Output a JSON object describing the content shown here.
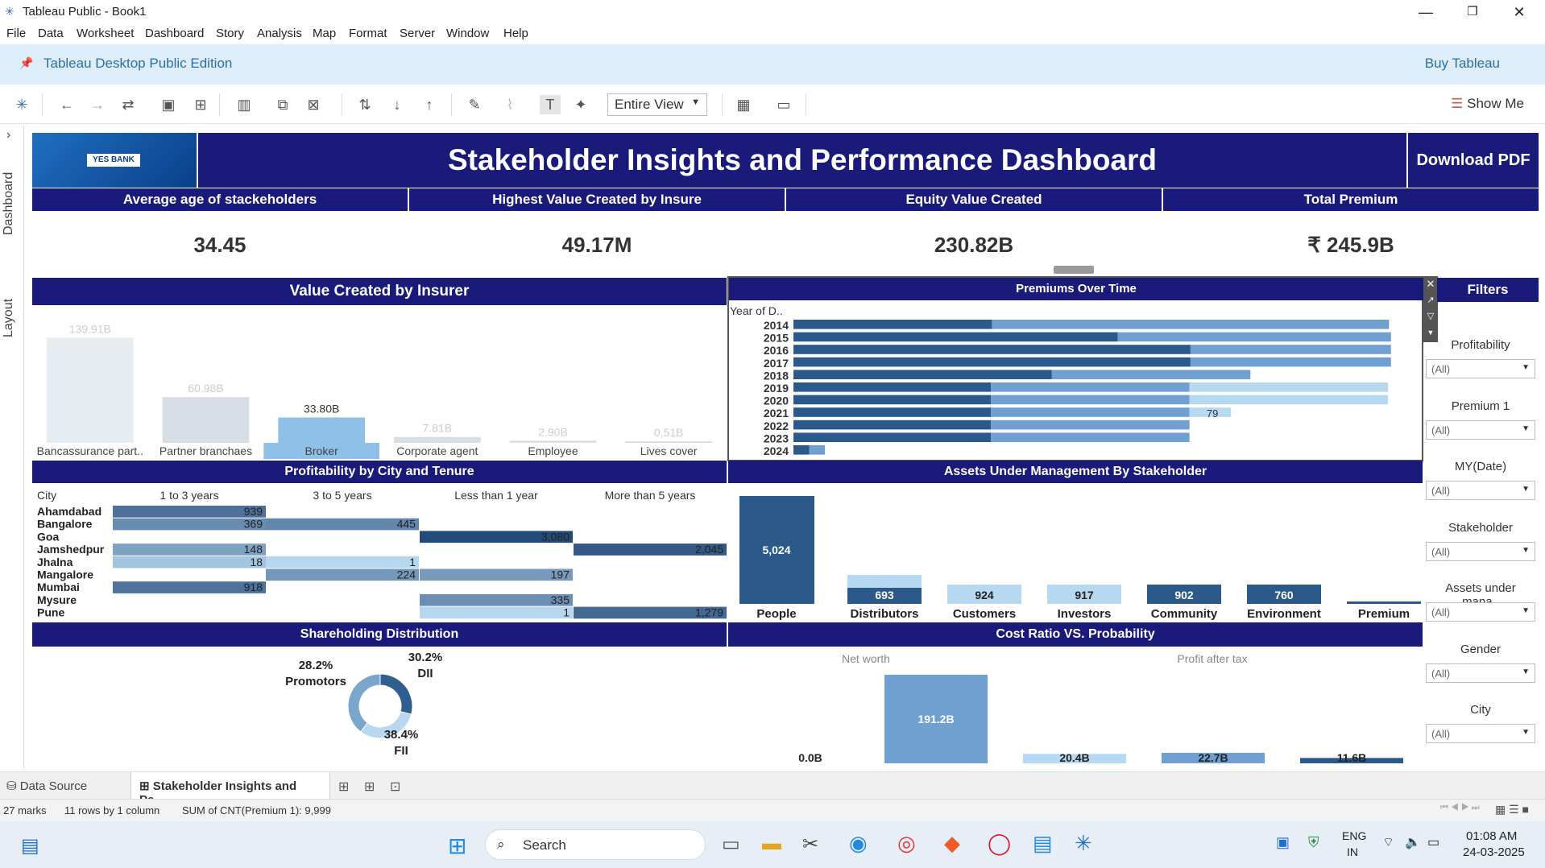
{
  "window": {
    "title": "Tableau Public - Book1",
    "minimize": "—",
    "maximize": "❐",
    "close": "✕"
  },
  "menu": [
    "File",
    "Data",
    "Worksheet",
    "Dashboard",
    "Story",
    "Analysis",
    "Map",
    "Format",
    "Server",
    "Window",
    "Help"
  ],
  "banner": {
    "edition": "Tableau Desktop Public Edition",
    "buy": "Buy Tableau"
  },
  "toolbar": {
    "fit": "Entire View",
    "show_me": "Show Me"
  },
  "side_tabs": {
    "dashboard": "Dashboard",
    "layout": "Layout",
    "toggle": "›"
  },
  "dashboard": {
    "logo_text": "YES BANK",
    "title": "Stakeholder Insights and Performance Dashboard",
    "download": "Download PDF",
    "kpis": [
      {
        "label": "Average age of stackeholders",
        "value": "34.45"
      },
      {
        "label": "Highest Value Created by Insure",
        "value": "49.17M"
      },
      {
        "label": "Equity Value Created",
        "value": "230.82B"
      },
      {
        "label": "Total Premium",
        "value": "₹ 245.9B"
      }
    ],
    "value_created": {
      "title": "Value Created by  Insurer",
      "chart_data": {
        "type": "bar",
        "categories": [
          "Bancassurance part..",
          "Partner branchaes",
          "Broker",
          "Corporate agent",
          "Employee",
          "Lives cover"
        ],
        "values": [
          139.91,
          60.98,
          33.8,
          7.81,
          2.9,
          0.51
        ],
        "labels": [
          "139.91B",
          "60.98B",
          "33.80B",
          "7.81B",
          "2.90B",
          "0.51B"
        ],
        "highlight": "Broker",
        "colors": {
          "highlight": "#8fc1e8",
          "faded": "#e6ecf0",
          "faded2": "#d8dee6"
        }
      }
    },
    "premiums": {
      "title": "Premiums Over Time",
      "axis_header": "Year of D..",
      "chart_data": {
        "type": "bar",
        "categories": [
          "2014",
          "2015",
          "2016",
          "2017",
          "2018",
          "2019",
          "2020",
          "2021",
          "2022",
          "2023",
          "2024"
        ],
        "series": [
          {
            "values": [
              202,
              330,
              404,
              404,
              263,
              201,
              201,
              201,
              201,
              201,
              16
            ]
          },
          {
            "values": [
              404,
              278,
              204,
              204,
              202,
              202,
              202,
              202,
              202,
              202,
              16
            ]
          },
          {
            "values": [
              0,
              0,
              0,
              0,
              0,
              202,
              202,
              42,
              0,
              0,
              0
            ]
          }
        ],
        "annotations": [
          {
            "category": "2021",
            "text": "79"
          }
        ]
      }
    },
    "filters": {
      "title": "Filters",
      "items": [
        {
          "label": "Profitability",
          "value": "(All)"
        },
        {
          "label": "Premium 1",
          "value": "(All)"
        },
        {
          "label": "MY(Date)",
          "value": "(All)"
        },
        {
          "label": "Stakeholder",
          "value": "(All)"
        },
        {
          "label": "Assets under mana..",
          "value": "(All)"
        },
        {
          "label": "Gender",
          "value": "(All)"
        },
        {
          "label": "City",
          "value": "(All)"
        }
      ]
    },
    "profitability": {
      "title": "Profitability by City and Tenure",
      "header_city": "City",
      "chart_data": {
        "type": "heatmap",
        "columns": [
          "1 to 3 years",
          "3 to 5 years",
          "Less than 1 year",
          "More than 5 years"
        ],
        "rows": [
          {
            "city": "Ahamdabad",
            "values": [
              939,
              null,
              null,
              null
            ]
          },
          {
            "city": "Bangalore",
            "values": [
              369,
              445,
              null,
              null
            ]
          },
          {
            "city": "Goa",
            "values": [
              null,
              null,
              3080,
              null
            ]
          },
          {
            "city": "Jamshedpur",
            "values": [
              148,
              null,
              null,
              2045
            ]
          },
          {
            "city": "Jhalna",
            "values": [
              18,
              1,
              null,
              null
            ]
          },
          {
            "city": "Mangalore",
            "values": [
              null,
              224,
              197,
              null
            ]
          },
          {
            "city": "Mumbai",
            "values": [
              918,
              null,
              null,
              null
            ]
          },
          {
            "city": "Mysure",
            "values": [
              null,
              null,
              335,
              null
            ]
          },
          {
            "city": "Pune",
            "values": [
              null,
              null,
              1,
              1279
            ]
          }
        ],
        "labels": {
          "Ahamdabad": [
            "939",
            "",
            "",
            ""
          ],
          "Bangalore": [
            "369",
            "445",
            "",
            ""
          ],
          "Goa": [
            "",
            "",
            "3,080",
            ""
          ],
          "Jamshedpur": [
            "148",
            "",
            "",
            "2,045"
          ],
          "Jhalna": [
            "18",
            "1",
            "",
            ""
          ],
          "Mangalore": [
            "",
            "224",
            "197",
            ""
          ],
          "Mumbai": [
            "918",
            "",
            "",
            ""
          ],
          "Mysure": [
            "",
            "",
            "335",
            ""
          ],
          "Pune": [
            "",
            "",
            "1",
            "1,279"
          ]
        }
      }
    },
    "aum": {
      "title": "Assets Under Management By Stakeholder",
      "chart_data": {
        "type": "bar",
        "categories": [
          "People",
          "Distributors",
          "Customers",
          "Investors",
          "Community",
          "Environment",
          "Premium"
        ],
        "values": [
          5024,
          693,
          924,
          917,
          902,
          760,
          40
        ],
        "labels": [
          "5,024",
          "693",
          "924",
          "917",
          "902",
          "760",
          ""
        ]
      }
    },
    "shareholding": {
      "title": "Shareholding Distribution",
      "chart_data": {
        "type": "pie",
        "slices": [
          {
            "name": "Promotors",
            "value": 28.2,
            "label": "28.2%"
          },
          {
            "name": "DII",
            "value": 30.2,
            "label": "30.2%"
          },
          {
            "name": "FII",
            "value": 38.4,
            "label": "38.4%"
          }
        ],
        "colors": [
          "#2f5f8f",
          "#b9d7ee",
          "#7aa6cc"
        ]
      }
    },
    "cost_ratio": {
      "title": "Cost Ratio VS. Probability",
      "chart_data": {
        "type": "bar",
        "groups": [
          "Net worth",
          "Profit after tax"
        ],
        "values": [
          0.0,
          191.2,
          20.4,
          22.7,
          11.6
        ],
        "labels": [
          "0.0B",
          "191.2B",
          "20.4B",
          "22.7B",
          "11.6B"
        ]
      }
    }
  },
  "sheet_tabs": {
    "data_source": "Data Source",
    "active": "Stakeholder Insights and Pe..."
  },
  "status": {
    "marks": "27 marks",
    "rows": "11 rows by 1 column",
    "sum": "SUM of CNT(Premium 1): 9,999"
  },
  "taskbar": {
    "search": "Search",
    "lang1": "ENG",
    "lang2": "IN",
    "time": "01:08 AM",
    "date": "24-03-2025"
  }
}
